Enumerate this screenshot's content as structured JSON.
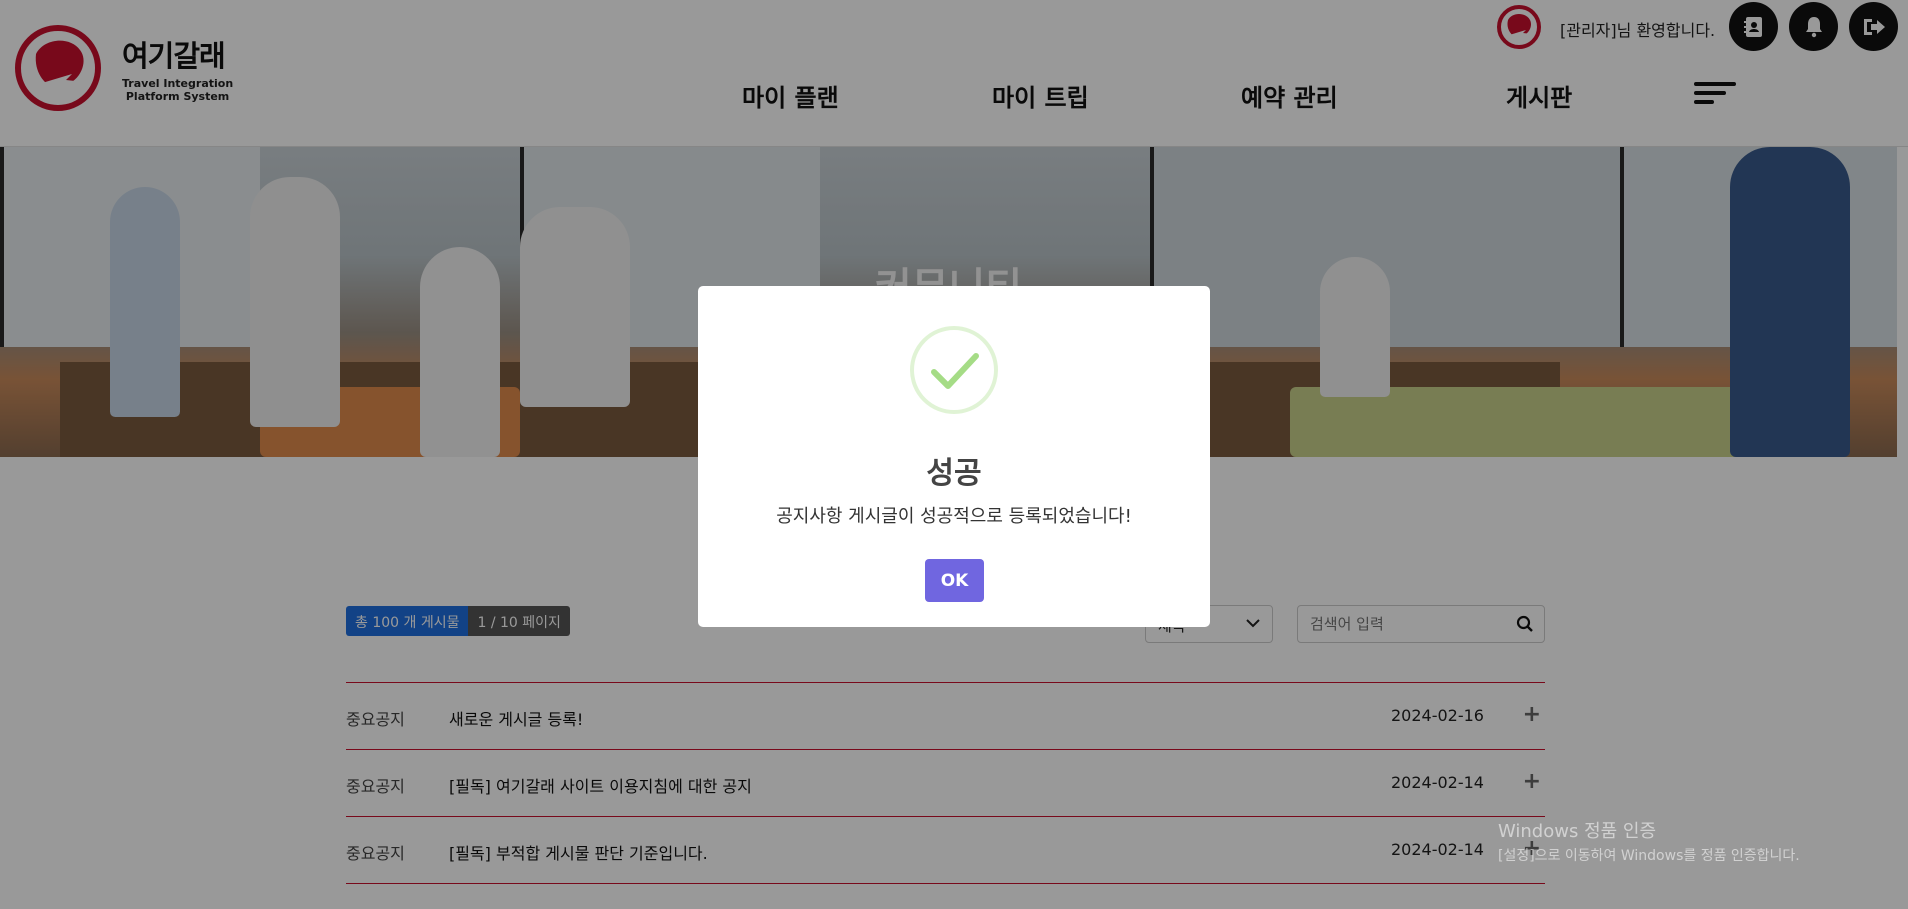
{
  "header": {
    "logo_title": "여기갈래",
    "logo_sub_line1": "Travel Integration",
    "logo_sub_line2": "Platform System",
    "welcome": "[관리자]님 환영합니다.",
    "nav": [
      "마이 플랜",
      "마이 트립",
      "예약 관리",
      "게시판"
    ]
  },
  "banner": {
    "title": "커뮤니티"
  },
  "board": {
    "total_label": "총 100 개 게시물",
    "page_label": "1 / 10 페이지",
    "select_value": "제목",
    "search_placeholder": "검색어 입력",
    "rows": [
      {
        "category": "중요공지",
        "title": "새로운 게시글 등록!",
        "date": "2024-02-16"
      },
      {
        "category": "중요공지",
        "title": "[필독] 여기갈래 사이트 이용지침에 대한 공지",
        "date": "2024-02-14"
      },
      {
        "category": "중요공지",
        "title": "[필독] 부적합 게시물 판단 기준입니다.",
        "date": "2024-02-14"
      }
    ]
  },
  "modal": {
    "title": "성공",
    "message": "공지사항 게시글이 성공적으로 등록되었습니다!",
    "ok_label": "OK"
  },
  "watermark": {
    "line1": "Windows 정품 인증",
    "line2": "[설정]으로 이동하여 Windows를 정품 인증합니다."
  },
  "colors": {
    "accent_red": "#c8102e",
    "ok_button": "#7066e0",
    "total_tag": "#1e6fe0",
    "success_green": "#a5dc86"
  }
}
